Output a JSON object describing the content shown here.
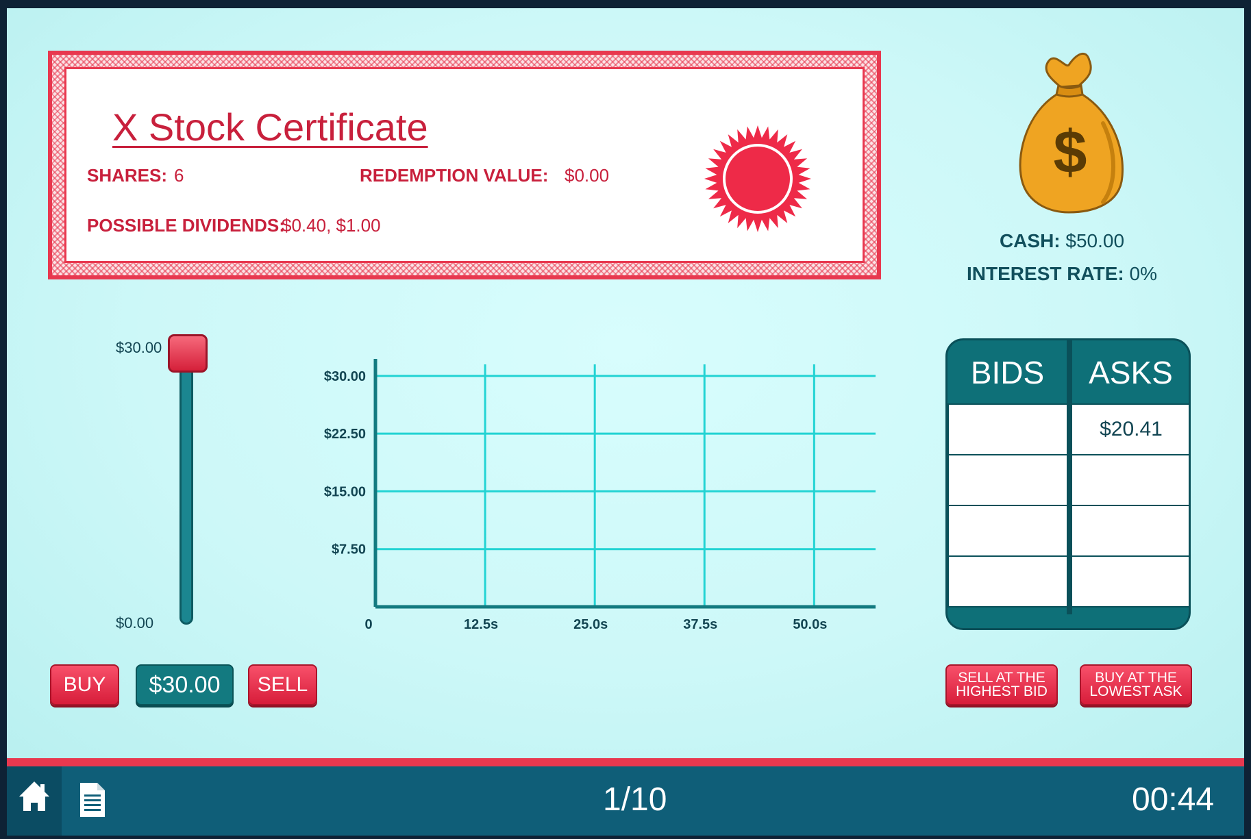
{
  "certificate": {
    "title": "X Stock Certificate",
    "shares_label": "SHARES:",
    "shares_value": "6",
    "redemption_label": "REDEMPTION VALUE:",
    "redemption_value": "$0.00",
    "dividends_label": "POSSIBLE DIVIDENDS:",
    "dividends_value": "$0.40, $1.00"
  },
  "account": {
    "cash_label": "CASH:",
    "cash_value": "$50.00",
    "interest_label": "INTEREST RATE:",
    "interest_value": "0%"
  },
  "slider": {
    "max_label": "$30.00",
    "min_label": "$0.00",
    "min": 0,
    "max": 30,
    "value": 30
  },
  "trade_buttons": {
    "buy": "BUY",
    "price": "$30.00",
    "sell": "SELL"
  },
  "chart_data": {
    "type": "line",
    "title": "",
    "xlabel": "",
    "ylabel": "",
    "x_ticks": [
      "0",
      "12.5s",
      "25.0s",
      "37.5s",
      "50.0s"
    ],
    "y_ticks": [
      "$7.50",
      "$15.00",
      "$22.50",
      "$30.00"
    ],
    "xlim": [
      0,
      57
    ],
    "ylim": [
      0,
      31.5
    ],
    "grid": true,
    "series": []
  },
  "order_book": {
    "bids_header": "BIDS",
    "asks_header": "ASKS",
    "bids": [
      "",
      "",
      "",
      ""
    ],
    "asks": [
      "$20.41",
      "",
      "",
      ""
    ]
  },
  "market_buttons": {
    "sell_highest_line1": "SELL AT THE",
    "sell_highest_line2": "HIGHEST BID",
    "buy_lowest_line1": "BUY AT THE",
    "buy_lowest_line2": "LOWEST ASK"
  },
  "bottom_bar": {
    "progress": "1/10",
    "timer": "00:44",
    "icons": [
      "home-icon",
      "document-icon"
    ]
  },
  "colors": {
    "accent_red": "#e8384f",
    "teal": "#137a80",
    "grid": "#22d3d3",
    "bar": "#0f5e78"
  }
}
